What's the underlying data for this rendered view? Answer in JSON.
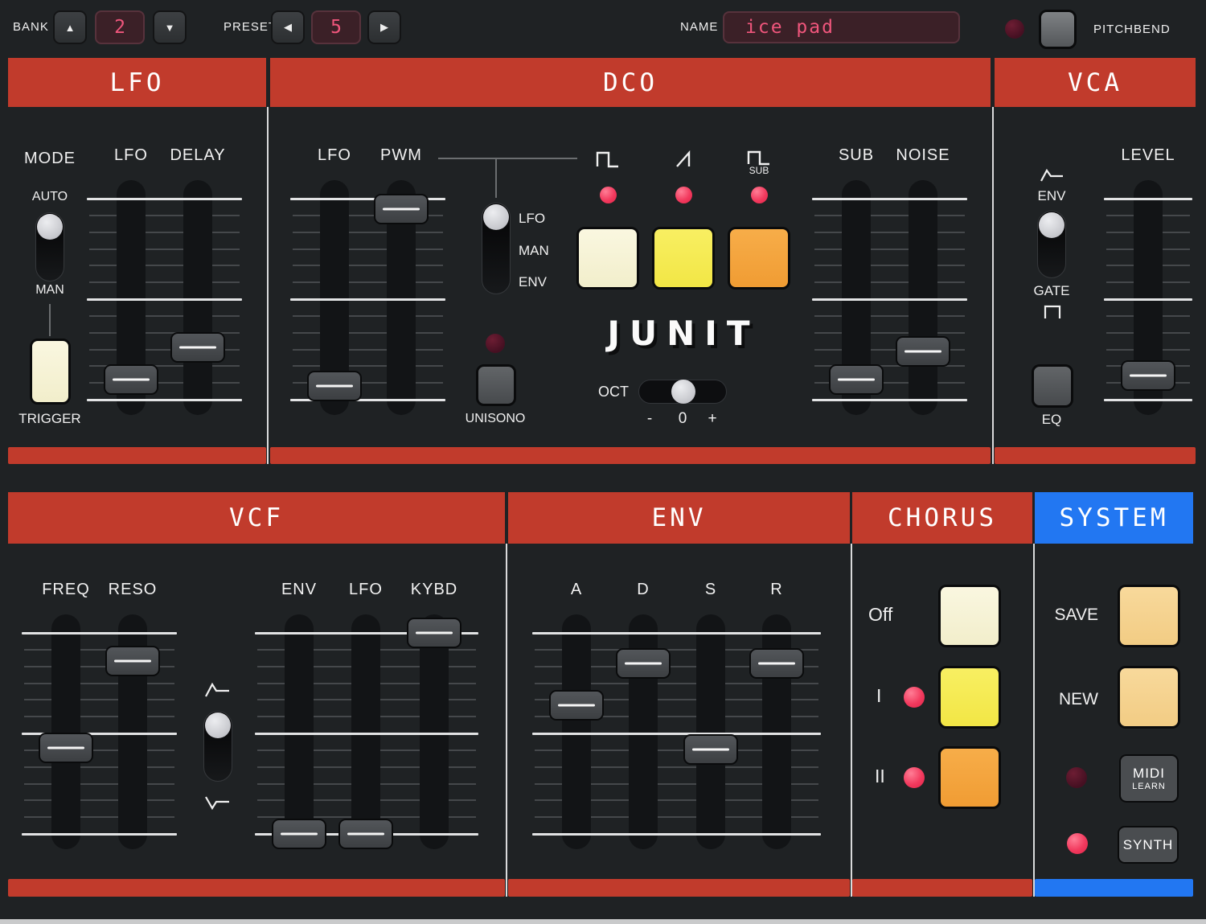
{
  "colors": {
    "accent_red": "#c13b2c",
    "accent_blue": "#2277f2",
    "led_pink": "#f23a5e",
    "value_pink": "#f0567c",
    "cream": "#f8f4da",
    "yellow": "#f6ec55",
    "orange": "#f5a943",
    "tan": "#f7d795"
  },
  "icons": {
    "up": "▲",
    "down": "▼",
    "left": "◀",
    "right": "▶"
  },
  "top_bar": {
    "bank": {
      "label": "BANK",
      "value": "2"
    },
    "preset": {
      "label": "PRESET",
      "value": "5"
    },
    "name": {
      "label": "NAME",
      "value": "ice pad"
    },
    "pitchbend": {
      "label": "PITCHBEND",
      "led": false
    }
  },
  "lfo": {
    "title": "LFO",
    "mode": {
      "label": "MODE",
      "top": "AUTO",
      "bottom": "MAN",
      "value": "AUTO",
      "toggle": {
        "count": 2,
        "position": 0
      }
    },
    "trigger": {
      "label": "TRIGGER"
    },
    "sliders": {
      "rate": {
        "label": "LFO",
        "value": 10
      },
      "delay": {
        "label": "DELAY",
        "value": 26
      }
    }
  },
  "dco": {
    "title": "DCO",
    "sliders": {
      "lfo": {
        "label": "LFO",
        "value": 7
      },
      "pwm": {
        "label": "PWM",
        "value": 95
      },
      "sub": {
        "label": "SUB",
        "value": 10
      },
      "noise": {
        "label": "NOISE",
        "value": 24
      }
    },
    "pwm_mode": {
      "options": [
        "LFO",
        "MAN",
        "ENV"
      ],
      "selected": "LFO",
      "toggle": {
        "count": 3,
        "position": 0
      }
    },
    "waveforms": [
      {
        "name": "pulse",
        "led": true
      },
      {
        "name": "saw",
        "led": true
      },
      {
        "name": "sub-square",
        "led": true,
        "caption": "SUB"
      }
    ],
    "unisono": {
      "label": "UNISONO",
      "led": false
    },
    "logo": "JUNIT",
    "oct": {
      "label": "OCT",
      "value": "0",
      "neg": "-",
      "zero": "0",
      "pos": "+"
    }
  },
  "vca": {
    "title": "VCA",
    "mode": {
      "top": "ENV",
      "bottom": "GATE",
      "value": "ENV",
      "toggle": {
        "count": 2,
        "position": 0
      }
    },
    "eq": {
      "label": "EQ"
    },
    "sliders": {
      "level": {
        "label": "LEVEL",
        "value": 12
      }
    }
  },
  "vcf": {
    "title": "VCF",
    "sliders": {
      "freq": {
        "label": "FREQ",
        "value": 43
      },
      "reso": {
        "label": "RESO",
        "value": 86
      },
      "env": {
        "label": "ENV",
        "value": 0
      },
      "lfo": {
        "label": "LFO",
        "value": 0
      },
      "kybd": {
        "label": "KYBD",
        "value": 100
      }
    },
    "polarity": {
      "value": "positive",
      "toggle": {
        "count": 2,
        "position": 0
      }
    }
  },
  "env": {
    "title": "ENV",
    "sliders": {
      "a": {
        "label": "A",
        "value": 64
      },
      "d": {
        "label": "D",
        "value": 85
      },
      "s": {
        "label": "S",
        "value": 42
      },
      "r": {
        "label": "R",
        "value": 85
      }
    }
  },
  "chorus": {
    "title": "CHORUS",
    "modes": [
      {
        "label": "Off"
      },
      {
        "label": "I",
        "led": true
      },
      {
        "label": "II",
        "led": true
      }
    ]
  },
  "system": {
    "title": "SYSTEM",
    "save": {
      "label": "SAVE"
    },
    "new": {
      "label": "NEW"
    },
    "midi_learn": {
      "line1": "MIDI",
      "line2": "LEARN",
      "led": false
    },
    "synth": {
      "label": "SYNTH",
      "led": true
    }
  }
}
